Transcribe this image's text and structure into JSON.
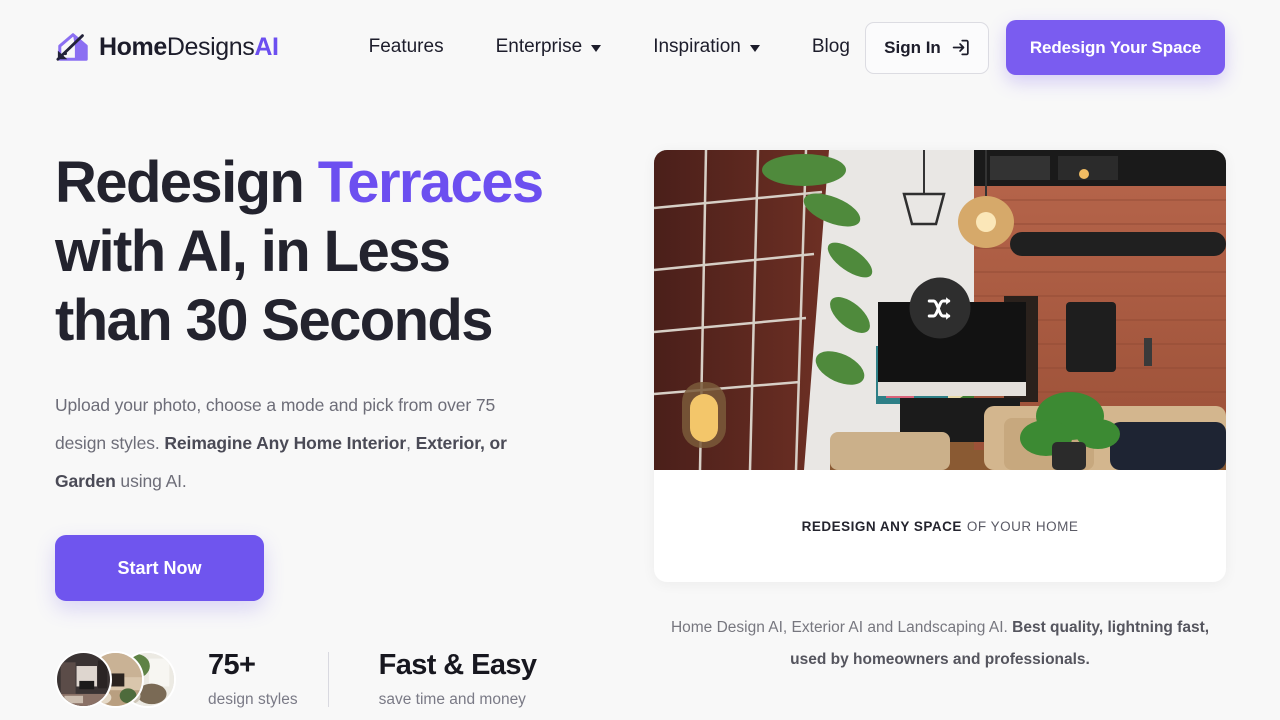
{
  "brand": {
    "logo_icon": "house-wand-icon",
    "name_part1": "Home",
    "name_part2": "Designs",
    "name_part3": "AI"
  },
  "nav": {
    "items": [
      {
        "label": "Features",
        "has_dropdown": false
      },
      {
        "label": "Enterprise",
        "has_dropdown": true
      },
      {
        "label": "Inspiration",
        "has_dropdown": true
      },
      {
        "label": "Blog",
        "has_dropdown": false
      }
    ]
  },
  "actions": {
    "signin_label": "Sign In",
    "signin_icon": "login-arrow-icon",
    "cta_label": "Redesign Your Space"
  },
  "hero": {
    "headline_line1_pre": "Redesign ",
    "headline_accent": "Terraces",
    "headline_line2": "with AI, in Less",
    "headline_line3": "than 30 Seconds",
    "subcopy_1": "Upload your photo, choose a mode and pick from over 75 design styles. ",
    "subcopy_bold_1": "Reimagine Any Home Interior",
    "subcopy_2": ", ",
    "subcopy_bold_2": "Exterior, or Garden",
    "subcopy_3": " using AI.",
    "start_button": "Start Now"
  },
  "stats": [
    {
      "value": "75+",
      "label": "design styles"
    },
    {
      "value": "Fast & Easy",
      "label": "save time and money"
    }
  ],
  "avatars": [
    {
      "name": "avatar-interior-dark"
    },
    {
      "name": "avatar-interior-beige"
    },
    {
      "name": "avatar-interior-light"
    }
  ],
  "card": {
    "image_alt": "loft-living-room-with-brick-wall",
    "shuffle_icon": "shuffle-icon",
    "caption_strong": "REDESIGN ANY SPACE",
    "caption_light": "OF YOUR HOME"
  },
  "footnote": {
    "text_1": "Home Design AI, Exterior AI and Landscaping AI. ",
    "text_bold": "Best quality, lightning fast, used by homeowners and professionals."
  },
  "colors": {
    "accent_purple": "#6c4ff0",
    "cta_purple": "#7a5cf0",
    "background": "#f8f8f8",
    "text_dark": "#23232e",
    "text_muted": "#6d6d78"
  }
}
